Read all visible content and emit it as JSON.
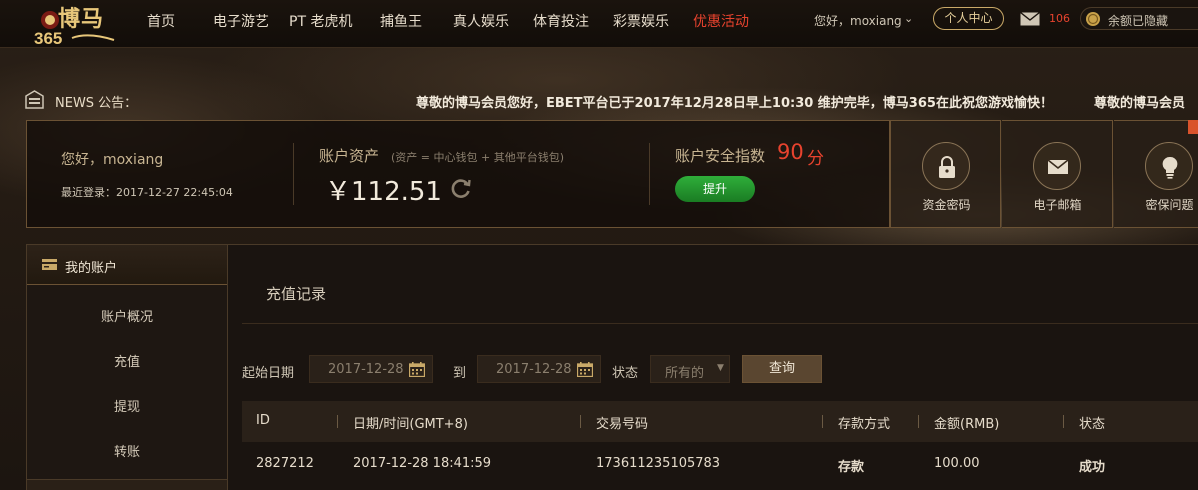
{
  "nav": {
    "logo_text": "博马365",
    "items": [
      "首页",
      "电子游艺",
      "PT 老虎机",
      "捕鱼王",
      "真人娱乐",
      "体育投注",
      "彩票娱乐",
      "优惠活动"
    ],
    "active_index": 7,
    "greeting": "您好，moxiang",
    "center_label": "个人中心",
    "mail_count": "106",
    "balance_label": "余额已隐藏"
  },
  "news": {
    "label": "NEWS 公告：",
    "message": "尊敬的博马会员您好，EBET平台已于2017年12月28日早上10:30 维护完毕，博马365在此祝您游戏愉快！",
    "message_repeat": "尊敬的博马会员"
  },
  "account": {
    "hello": "您好，moxiang",
    "last_login": "最近登录：2017-12-27 22:45:04",
    "assets_label": "账户资产",
    "assets_note": "(资产 = 中心钱包 + 其他平台钱包)",
    "assets_value": "￥112.51",
    "safety_label": "账户安全指数",
    "safety_score": "90",
    "safety_unit": "分",
    "upgrade_label": "提升"
  },
  "security_tiles": [
    {
      "label": "资金密码",
      "icon": "lock-icon"
    },
    {
      "label": "电子邮箱",
      "icon": "mail-icon"
    },
    {
      "label": "密保问题",
      "icon": "bulb-icon"
    }
  ],
  "sidebar": {
    "title": "我的账户",
    "items": [
      "账户概况",
      "充值",
      "提现",
      "转账"
    ]
  },
  "main": {
    "title": "充值记录",
    "filter": {
      "start_label": "起始日期",
      "start_date": "2017-12-28",
      "to_label": "到",
      "end_date": "2017-12-28",
      "status_label": "状态",
      "status_value": "所有的",
      "query_label": "查询"
    },
    "table": {
      "headers": [
        "ID",
        "日期/时间(GMT+8)",
        "交易号码",
        "存款方式",
        "金额(RMB)",
        "状态"
      ],
      "rows": [
        [
          "2827212",
          "2017-12-28 18:41:59",
          "173611235105783",
          "存款",
          "100.00",
          "成功"
        ]
      ]
    }
  },
  "colors": {
    "accent_red": "#e8432e",
    "gold": "#c9a968",
    "green": "#2fae3a"
  }
}
